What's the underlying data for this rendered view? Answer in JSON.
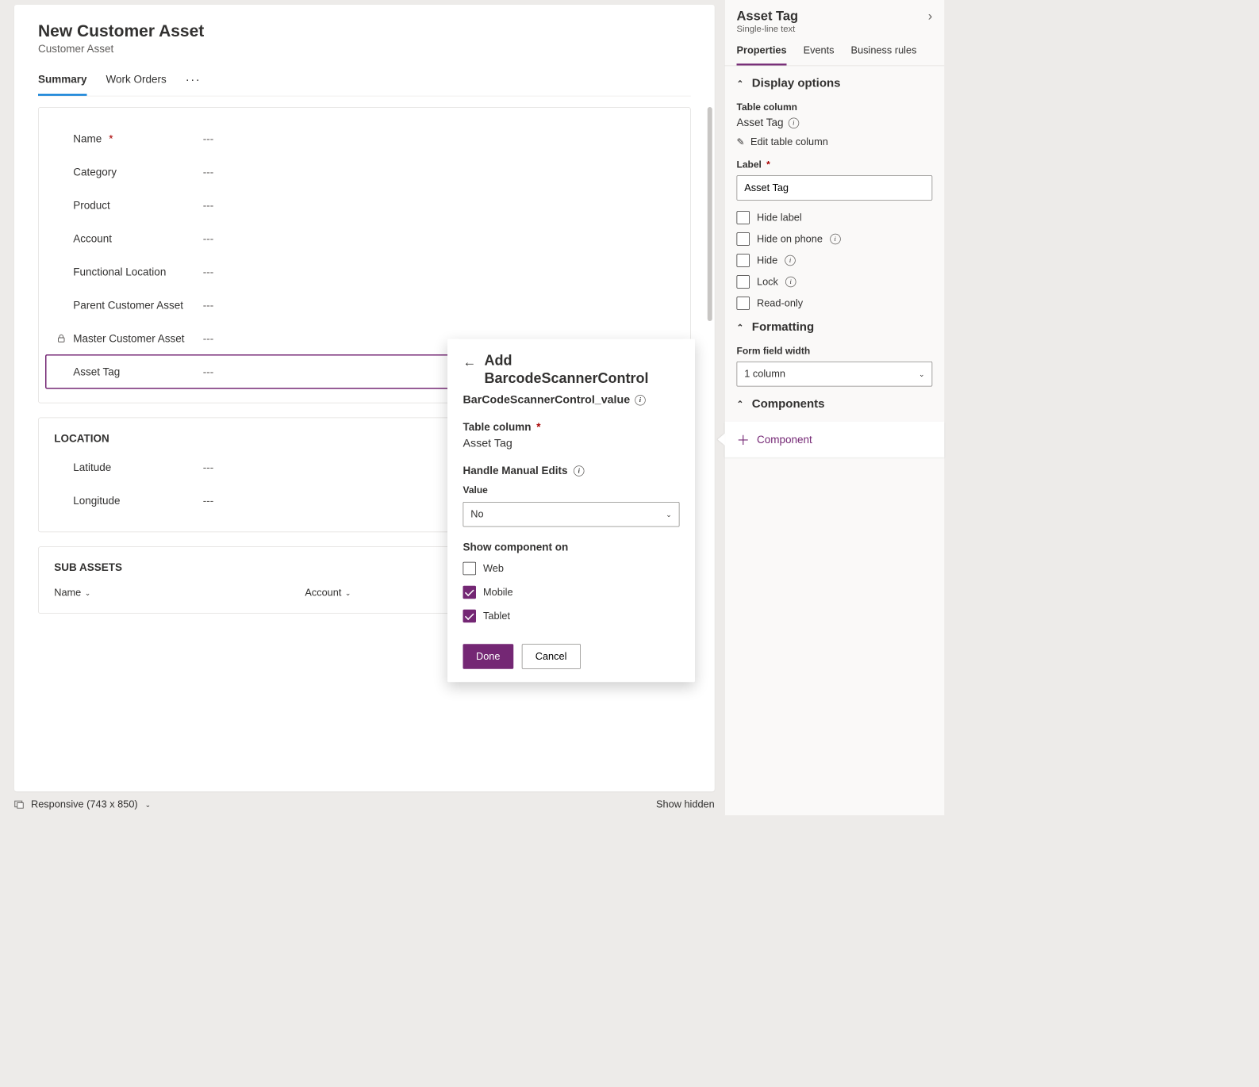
{
  "form": {
    "title": "New Customer Asset",
    "subtitle": "Customer Asset",
    "tabs": [
      "Summary",
      "Work Orders"
    ],
    "moreGlyph": "···"
  },
  "fields": {
    "placeholder": "---",
    "items": [
      {
        "label": "Name",
        "required": true,
        "locked": false
      },
      {
        "label": "Category",
        "required": false,
        "locked": false
      },
      {
        "label": "Product",
        "required": false,
        "locked": false
      },
      {
        "label": "Account",
        "required": false,
        "locked": false
      },
      {
        "label": "Functional Location",
        "required": false,
        "locked": false
      },
      {
        "label": "Parent Customer Asset",
        "required": false,
        "locked": false
      },
      {
        "label": "Master Customer Asset",
        "required": false,
        "locked": true
      },
      {
        "label": "Asset Tag",
        "required": false,
        "locked": false,
        "selected": true
      }
    ]
  },
  "sections": {
    "location": {
      "header": "LOCATION",
      "lat": "Latitude",
      "lon": "Longitude"
    },
    "subassets": {
      "header": "SUB ASSETS",
      "cols": [
        "Name",
        "Account"
      ]
    }
  },
  "footer": {
    "responsive": "Responsive (743 x 850)",
    "showHidden": "Show hidden"
  },
  "popover": {
    "addPrefix": "Add",
    "title": "BarcodeScannerControl",
    "subtitle": "BarCodeScannerControl_value",
    "tableColumnLabel": "Table column",
    "tableColumnValue": "Asset Tag",
    "handleManualLabel": "Handle Manual Edits",
    "valueLabel": "Value",
    "valueSelected": "No",
    "showComponentLabel": "Show component on",
    "checks": [
      {
        "label": "Web",
        "checked": false
      },
      {
        "label": "Mobile",
        "checked": true
      },
      {
        "label": "Tablet",
        "checked": true
      }
    ],
    "done": "Done",
    "cancel": "Cancel"
  },
  "side": {
    "title": "Asset Tag",
    "type": "Single-line text",
    "tabs": [
      "Properties",
      "Events",
      "Business rules"
    ],
    "display": {
      "header": "Display options",
      "tableColLabel": "Table column",
      "tableColValue": "Asset Tag",
      "editTableCol": "Edit table column",
      "labelLabel": "Label",
      "labelValue": "Asset Tag",
      "checks": [
        {
          "label": "Hide label",
          "info": false
        },
        {
          "label": "Hide on phone",
          "info": true
        },
        {
          "label": "Hide",
          "info": true
        },
        {
          "label": "Lock",
          "info": true
        },
        {
          "label": "Read-only",
          "info": false
        }
      ]
    },
    "formatting": {
      "header": "Formatting",
      "widthLabel": "Form field width",
      "widthValue": "1 column"
    },
    "components": {
      "header": "Components",
      "add": "Component"
    }
  }
}
